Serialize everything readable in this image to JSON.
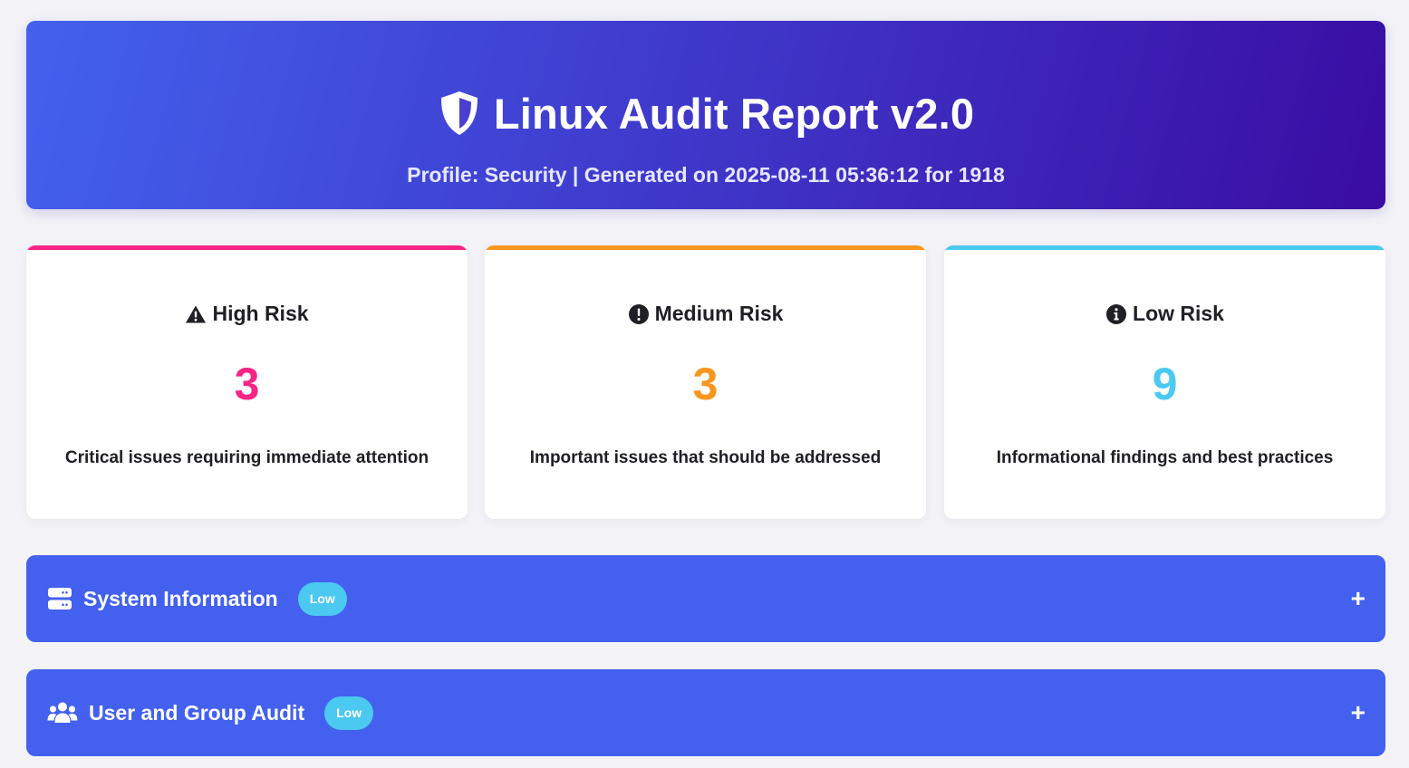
{
  "header": {
    "icon": "shield-icon",
    "title": "Linux Audit Report v2.0",
    "subtitle": "Profile: Security | Generated on 2025-08-11 05:36:12 for 1918"
  },
  "colors": {
    "high": "#f72585",
    "medium": "#f8961e",
    "low": "#4cc9f0",
    "section_bg": "#4361ee"
  },
  "risk_cards": [
    {
      "icon": "warning-triangle-icon",
      "label": "High Risk",
      "count": "3",
      "description": "Critical issues requiring immediate attention"
    },
    {
      "icon": "exclamation-circle-icon",
      "label": "Medium Risk",
      "count": "3",
      "description": "Important issues that should be addressed"
    },
    {
      "icon": "info-circle-icon",
      "label": "Low Risk",
      "count": "9",
      "description": "Informational findings and best practices"
    }
  ],
  "sections": [
    {
      "icon": "server-icon",
      "title": "System Information",
      "badge": "Low",
      "toggle": "+"
    },
    {
      "icon": "users-icon",
      "title": "User and Group Audit",
      "badge": "Low",
      "toggle": "+"
    }
  ]
}
